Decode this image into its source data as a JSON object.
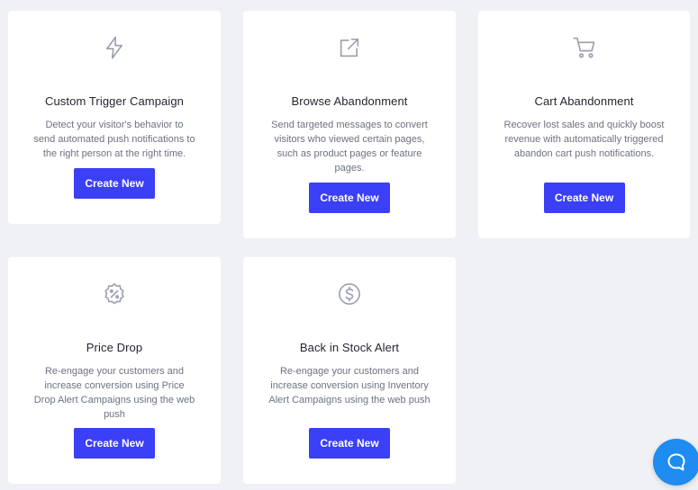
{
  "colors": {
    "accent": "#3b3ff5",
    "chat": "#1e8cf0",
    "background": "#f0f1f5",
    "icon": "#9aa0ad"
  },
  "cards": [
    {
      "icon": "lightning-icon",
      "title": "Custom Trigger Campaign",
      "description": "Detect your visitor's behavior to send automated push notifications to the right person at the right time.",
      "button": "Create New"
    },
    {
      "icon": "external-link-icon",
      "title": "Browse Abandonment",
      "description": "Send targeted messages to convert visitors who viewed certain pages, such as product pages or feature pages.",
      "button": "Create New"
    },
    {
      "icon": "cart-icon",
      "title": "Cart Abandonment",
      "description": "Recover lost sales and quickly boost revenue with automatically triggered abandon cart push notifications.",
      "button": "Create New"
    },
    {
      "icon": "discount-badge-icon",
      "title": "Price Drop",
      "description": "Re-engage your customers and increase conversion using Price Drop Alert Campaigns using the web push",
      "button": "Create New"
    },
    {
      "icon": "dollar-circle-icon",
      "title": "Back in Stock Alert",
      "description": "Re-engage your customers and increase conversion using Inventory Alert Campaigns using the web push",
      "button": "Create New"
    }
  ],
  "chat": {
    "icon": "chat-bubble-icon"
  }
}
